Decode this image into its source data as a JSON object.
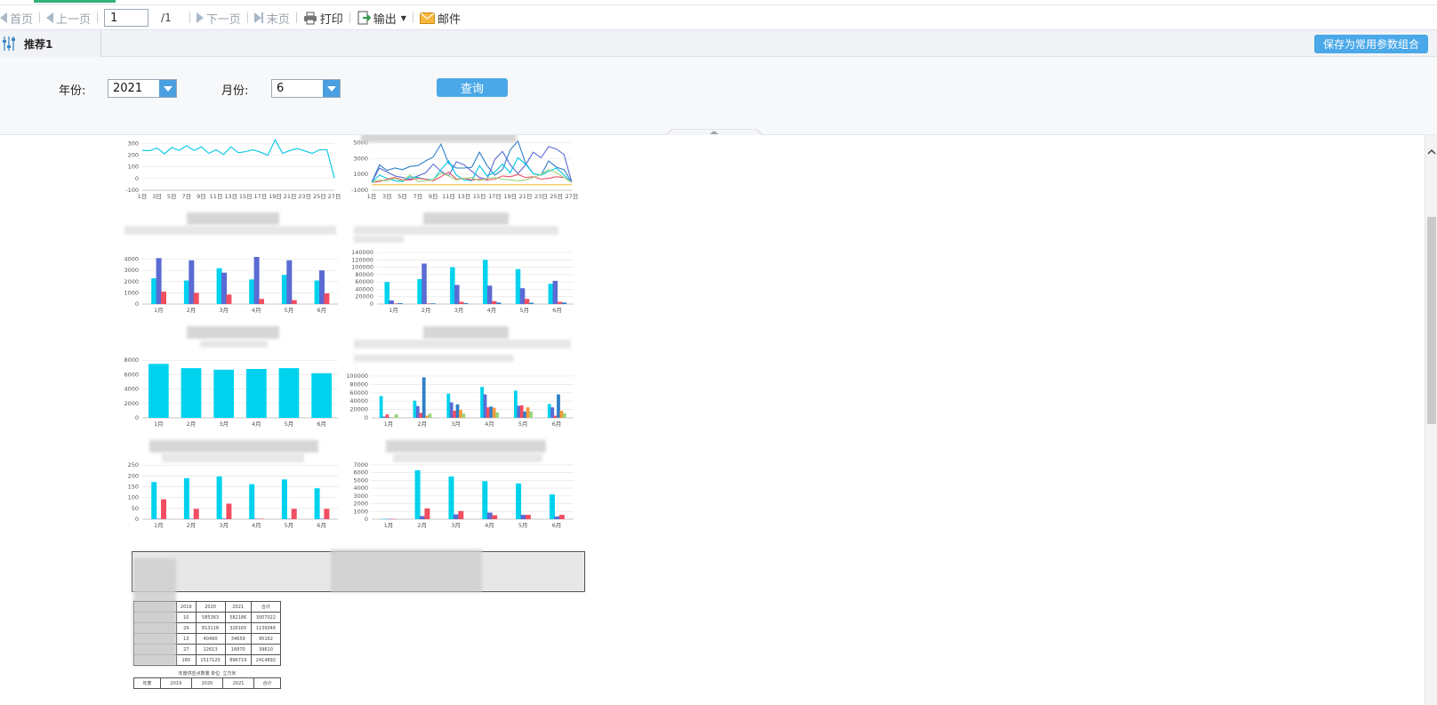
{
  "toolbar": {
    "first_label": "首页",
    "prev_label": "上一页",
    "page_value": "1",
    "page_total": "/1",
    "next_label": "下一页",
    "last_label": "末页",
    "print_label": "打印",
    "export_label": "输出",
    "mail_label": "邮件"
  },
  "param_tab": {
    "tab_label": "推荐1",
    "save_label": "保存为常用参数组合"
  },
  "params": {
    "year_label": "年份:",
    "year_value": "2021",
    "month_label": "月份:",
    "month_value": "6",
    "query_label": "查询"
  },
  "colors": {
    "accent_blue": "#4aa8e8",
    "cyan": "#00d2ee",
    "indigo": "#5a6bd4",
    "red": "#f24e62",
    "deep_blue": "#2f7fc8",
    "yellow": "#f5c23b",
    "green": "#9bd47a",
    "orange": "#f49a3c",
    "pink": "#f0a0c0",
    "toolbar_green": "#34b27a"
  },
  "icons": {
    "first": "first-page-icon",
    "prev": "prev-page-icon",
    "next": "next-page-icon",
    "last": "last-page-icon",
    "print": "printer-icon",
    "export": "export-icon",
    "mail": "mail-icon",
    "params": "sliders-icon"
  },
  "chart_data": [
    {
      "type": "line",
      "x": [
        "1日",
        "3日",
        "5日",
        "7日",
        "9日",
        "11日",
        "13日",
        "15日",
        "17日",
        "19日",
        "21日",
        "23日",
        "25日",
        "27日"
      ],
      "x_values": [
        1,
        2,
        3,
        4,
        5,
        6,
        7,
        8,
        9,
        10,
        11,
        12,
        13,
        14,
        15,
        16,
        17,
        18,
        19,
        20,
        21,
        22,
        23,
        24,
        25,
        26,
        27
      ],
      "series": [
        {
          "values": [
            240,
            238,
            260,
            210,
            265,
            240,
            280,
            240,
            270,
            215,
            245,
            205,
            270,
            220,
            230,
            245,
            225,
            200,
            330,
            215,
            240,
            255,
            235,
            215,
            245,
            245,
            5
          ],
          "color": "#00c6e6"
        }
      ],
      "y_ticks": [
        -100,
        0,
        100,
        200,
        300
      ],
      "ylim": [
        -100,
        340
      ],
      "xlim": [
        1,
        27
      ]
    },
    {
      "type": "line",
      "x": [
        "1日",
        "3日",
        "5日",
        "7日",
        "9日",
        "11日",
        "13日",
        "15日",
        "17日",
        "19日",
        "21日",
        "23日",
        "25日",
        "27日"
      ],
      "x_values": [
        1,
        2,
        3,
        4,
        5,
        6,
        7,
        8,
        9,
        10,
        11,
        12,
        13,
        14,
        15,
        16,
        17,
        18,
        19,
        20,
        21,
        22,
        23,
        24,
        25,
        26,
        27
      ],
      "series": [
        {
          "values": [
            0,
            2200,
            1500,
            1800,
            1600,
            2000,
            2100,
            2700,
            3200,
            4800,
            2400,
            1800,
            1800,
            1900,
            3800,
            2100,
            900,
            1600,
            4100,
            5200,
            2400,
            1100,
            900,
            2700,
            1900,
            1600,
            0
          ],
          "color": "#2f7fc8"
        },
        {
          "values": [
            0,
            1800,
            1300,
            800,
            600,
            400,
            800,
            1200,
            2300,
            1400,
            800,
            2600,
            2200,
            1400,
            600,
            400,
            2900,
            3900,
            2200,
            1100,
            2200,
            3800,
            3100,
            4500,
            4200,
            3500,
            0
          ],
          "color": "#5a6bd4"
        },
        {
          "values": [
            0,
            900,
            500,
            200,
            100,
            700,
            600,
            400,
            300,
            1600,
            2700,
            900,
            300,
            200,
            2100,
            800,
            1300,
            2300,
            1200,
            3100,
            2300,
            1100,
            900,
            1400,
            1800,
            900,
            0
          ],
          "color": "#00c6e6"
        },
        {
          "values": [
            0,
            100,
            400,
            600,
            300,
            300,
            500,
            400,
            200,
            700,
            1300,
            400,
            500,
            300,
            400,
            300,
            400,
            800,
            700,
            1000,
            600,
            700,
            400,
            500,
            700,
            600,
            0
          ],
          "color": "#f24e62"
        },
        {
          "values": [
            0,
            300,
            200,
            500,
            200,
            900,
            100,
            200,
            300,
            1200,
            800,
            300,
            500,
            600,
            200,
            500,
            600,
            400,
            300,
            200,
            300,
            600,
            1000,
            1600,
            1200,
            600,
            0
          ],
          "color": "#9bd47a"
        },
        {
          "values": [
            -300,
            -300,
            -300,
            -300,
            -300,
            -300,
            -300,
            -300,
            -300,
            -300,
            -300,
            -300,
            -300,
            -300,
            -300,
            -300,
            -300,
            -300,
            -300,
            -300,
            -300,
            -300,
            -300,
            -300,
            -300,
            -300,
            -300
          ],
          "color": "#f5c23b"
        }
      ],
      "y_ticks": [
        -1000,
        1000,
        3000,
        5000
      ],
      "ylim": [
        -1000,
        5500
      ],
      "xlim": [
        1,
        27
      ]
    },
    {
      "type": "bar",
      "categories": [
        "1月",
        "2月",
        "3月",
        "4月",
        "5月",
        "6月"
      ],
      "series": [
        {
          "values": [
            2300,
            2100,
            3200,
            2200,
            2600,
            2100
          ],
          "color": "#00d2ee"
        },
        {
          "values": [
            4100,
            3900,
            2800,
            4200,
            3900,
            3000
          ],
          "color": "#5a6bd4"
        },
        {
          "values": [
            1100,
            1000,
            850,
            450,
            350,
            950
          ],
          "color": "#f24e62"
        }
      ],
      "y_ticks": [
        0,
        1000,
        2000,
        3000,
        4000
      ],
      "ylim": [
        0,
        4600
      ]
    },
    {
      "type": "bar",
      "categories": [
        "1月",
        "2月",
        "3月",
        "4月",
        "5月",
        "6月"
      ],
      "series": [
        {
          "values": [
            60000,
            68000,
            100000,
            120000,
            95000,
            55000
          ],
          "color": "#00d2ee"
        },
        {
          "values": [
            10000,
            110000,
            52000,
            50000,
            43000,
            63000
          ],
          "color": "#5a6bd4"
        },
        {
          "values": [
            1500,
            1500,
            6000,
            8000,
            14000,
            6000
          ],
          "color": "#f24e62"
        },
        {
          "values": [
            2500,
            2000,
            2500,
            4000,
            3500,
            4000
          ],
          "color": "#2f7fc8"
        }
      ],
      "y_ticks": [
        0,
        20000,
        40000,
        60000,
        80000,
        100000,
        120000,
        140000
      ],
      "ylim": [
        0,
        145000
      ]
    },
    {
      "type": "bar",
      "categories": [
        "1月",
        "2月",
        "3月",
        "4月",
        "5月",
        "6月"
      ],
      "series": [
        {
          "values": [
            7500,
            6900,
            6700,
            6800,
            6900,
            6200
          ],
          "color": "#00d2ee"
        }
      ],
      "y_ticks": [
        0,
        2000,
        4000,
        6000,
        8000
      ],
      "ylim": [
        0,
        8400
      ]
    },
    {
      "type": "bar",
      "categories": [
        "1月",
        "2月",
        "3月",
        "4月",
        "5月",
        "6月"
      ],
      "series": [
        {
          "values": [
            52000,
            41000,
            58000,
            74000,
            65000,
            33000
          ],
          "color": "#00d2ee"
        },
        {
          "values": [
            3000,
            28000,
            37000,
            56000,
            29000,
            25000
          ],
          "color": "#5a6bd4"
        },
        {
          "values": [
            8000,
            12000,
            17000,
            25000,
            30000,
            5000
          ],
          "color": "#f24e62"
        },
        {
          "values": [
            1000,
            97000,
            32000,
            27000,
            15000,
            56000
          ],
          "color": "#2f7fc8"
        },
        {
          "values": [
            1000,
            5000,
            19000,
            24000,
            25000,
            17000
          ],
          "color": "#f49a3c"
        },
        {
          "values": [
            8000,
            10000,
            10000,
            13000,
            15000,
            11000
          ],
          "color": "#9bd47a"
        }
      ],
      "y_ticks": [
        0,
        20000,
        40000,
        60000,
        80000,
        100000
      ],
      "ylim": [
        0,
        102000
      ]
    },
    {
      "type": "bar",
      "categories": [
        "1月",
        "2月",
        "3月",
        "4月",
        "5月",
        "6月"
      ],
      "series": [
        {
          "values": [
            172,
            190,
            198,
            162,
            184,
            143
          ],
          "color": "#00d2ee"
        },
        {
          "values": [
            2,
            2,
            3,
            2,
            2,
            2
          ],
          "color": "#5a6bd4"
        },
        {
          "values": [
            92,
            48,
            72,
            2,
            48,
            48
          ],
          "color": "#f24e62"
        }
      ],
      "y_ticks": [
        0,
        50,
        100,
        150,
        200,
        250
      ],
      "ylim": [
        0,
        255
      ]
    },
    {
      "type": "bar",
      "categories": [
        "1月",
        "2月",
        "3月",
        "4月",
        "5月",
        "6月"
      ],
      "series": [
        {
          "values": [
            40,
            6300,
            5500,
            4900,
            4600,
            3200
          ],
          "color": "#00d2ee"
        },
        {
          "values": [
            40,
            400,
            620,
            850,
            560,
            350
          ],
          "color": "#5a6bd4"
        },
        {
          "values": [
            40,
            1400,
            1050,
            520,
            560,
            560
          ],
          "color": "#f24e62"
        }
      ],
      "y_ticks": [
        0,
        1000,
        2000,
        3000,
        4000,
        5000,
        6000,
        7000
      ],
      "ylim": [
        0,
        7100
      ]
    }
  ],
  "table_snippet": {
    "rows": [
      [
        "2019",
        "2020",
        "2021",
        "合计"
      ],
      [
        "10",
        "585363",
        "582186",
        "3007022"
      ],
      [
        "29",
        "813118",
        "326165",
        "1139346"
      ],
      [
        "13",
        "40490",
        "34659",
        "95162"
      ],
      [
        "27",
        "22613",
        "16870",
        "39610"
      ],
      [
        "180",
        "1517120",
        "896719",
        "2414892"
      ]
    ],
    "bottom_caption": "年度供应点数量 单位: 立方米",
    "bottom_row": [
      "年度",
      "2019",
      "2020",
      "2021",
      "合计"
    ]
  }
}
